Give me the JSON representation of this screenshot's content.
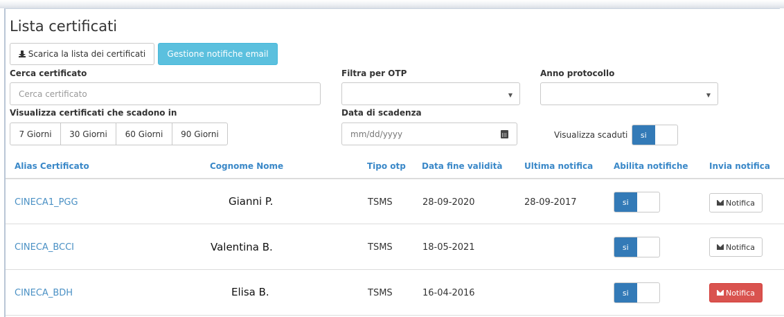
{
  "page": {
    "title": "Lista certificati",
    "download_button": "Scarica la lista dei certificati",
    "email_button": "Gestione notifiche email"
  },
  "filters": {
    "search_label": "Cerca certificato",
    "search_placeholder": "Cerca certificato",
    "otp_label": "Filtra per OTP",
    "otp_value": "",
    "year_label": "Anno protocollo",
    "year_value": "",
    "expire_label": "Visualizza certificati che scadono in",
    "expire_options": [
      "7 Giorni",
      "30 Giorni",
      "60 Giorni",
      "90 Giorni"
    ],
    "date_label": "Data di scadenza",
    "date_placeholder": "mm/dd/yyyy",
    "show_expired_label": "Visualizza scaduti",
    "show_expired_toggle": "si"
  },
  "table": {
    "headers": [
      "Alias Certificato",
      "Cognome Nome",
      "Tipo otp",
      "Data fine validità",
      "Ultima notifica",
      "Abilita notifiche",
      "Invia notifica"
    ],
    "rows": [
      {
        "alias": "CINECA1_PGG",
        "name": "Gianni P.",
        "tipo": "TSMS",
        "data_fine": "28-09-2020",
        "ultima": "28-09-2017",
        "toggle": "si",
        "notifica": "Notifica",
        "notifica_style": "default"
      },
      {
        "alias": "CINECA_BCCI",
        "name": "Valentina B.",
        "tipo": "TSMS",
        "data_fine": "18-05-2021",
        "ultima": "",
        "toggle": "si",
        "notifica": "Notifica",
        "notifica_style": "default"
      },
      {
        "alias": "CINECA_BDH",
        "name": "Elisa B.",
        "tipo": "TSMS",
        "data_fine": "16-04-2016",
        "ultima": "",
        "toggle": "si",
        "notifica": "Notifica",
        "notifica_style": "danger"
      }
    ]
  },
  "colors": {
    "link": "#4a90c4",
    "info": "#5bc0de",
    "primary": "#337ab7",
    "danger": "#d9534f"
  }
}
